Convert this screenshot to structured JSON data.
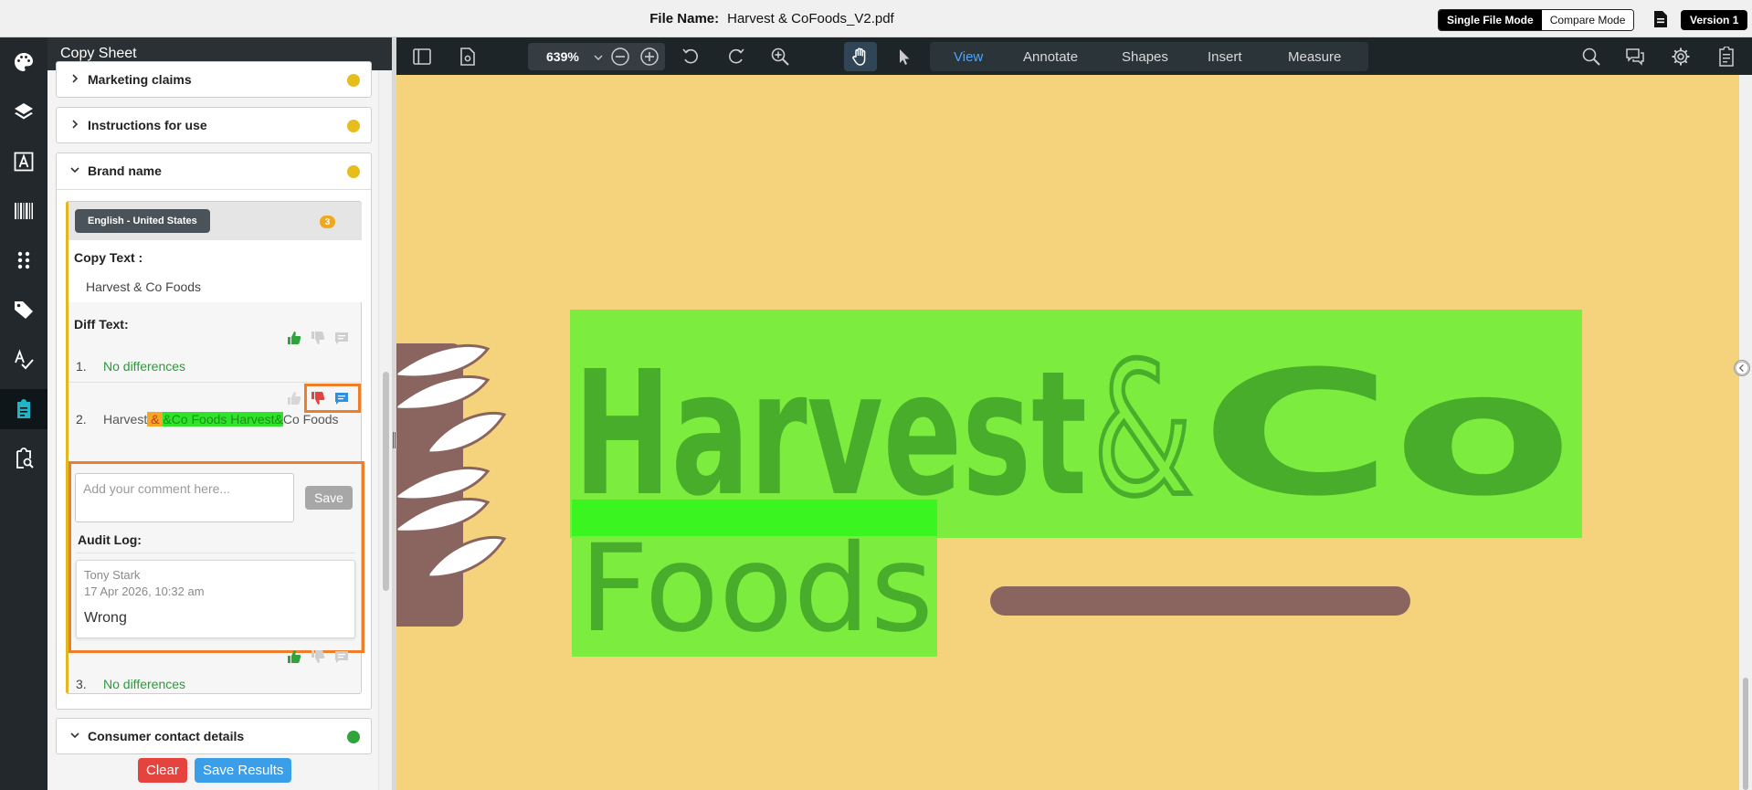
{
  "header": {
    "file_name_label": "File Name:",
    "file_name": "Harvest & CoFoods_V2.pdf",
    "single_mode": "Single File Mode",
    "compare_mode": "Compare Mode",
    "version": "Version 1"
  },
  "rail": {
    "icons": [
      "palette-icon",
      "layers-icon",
      "text-icon",
      "barcode-icon",
      "grid-dots-icon",
      "tag-icon",
      "spellcheck-icon",
      "clipboard-icon",
      "search-document-icon"
    ]
  },
  "panel": {
    "title": "Copy Sheet",
    "sections": [
      {
        "label": "Marketing claims",
        "status_color": "#e5be1c"
      },
      {
        "label": "Instructions for use",
        "status_color": "#e5be1c"
      },
      {
        "label": "Brand name",
        "status_color": "#e5be1c"
      },
      {
        "label": "Consumer contact details",
        "status_color": "#2fa43a"
      }
    ],
    "brand": {
      "language": "English - United States",
      "count": "3",
      "copy_text_label": "Copy Text :",
      "copy_text_value": "Harvest & Co Foods",
      "diff_text_label": "Diff Text:",
      "diffs": [
        {
          "num": "1.",
          "text": "No differences"
        },
        {
          "num": "2.",
          "plain_start": "Harvest",
          "deleted": " & ",
          "inserted": "&Co Foods Harvest&",
          "plain_end": "Co Foods"
        },
        {
          "num": "3.",
          "text": "No differences"
        }
      ],
      "comment_placeholder": "Add your comment here...",
      "save_label": "Save",
      "audit_log_label": "Audit Log:",
      "audit": {
        "user": "Tony Stark",
        "time": "17 Apr 2026, 10:32 am",
        "message": "Wrong"
      }
    },
    "clear_label": "Clear",
    "save_results_label": "Save Results"
  },
  "viewer": {
    "zoom": "639%",
    "tabs": [
      "View",
      "Annotate",
      "Shapes",
      "Insert",
      "Measure"
    ],
    "active_tab": "View",
    "artwork": {
      "word1": "Harvest",
      "amp": "&",
      "word2": "Co",
      "word3": "Foods"
    }
  },
  "colors": {
    "canvas_bg": "#f5d37c",
    "logo_green": "#48ad2b",
    "highlight_green": "#7ced3f",
    "brown": "#8a6560",
    "accent_orange": "#f07d28"
  }
}
